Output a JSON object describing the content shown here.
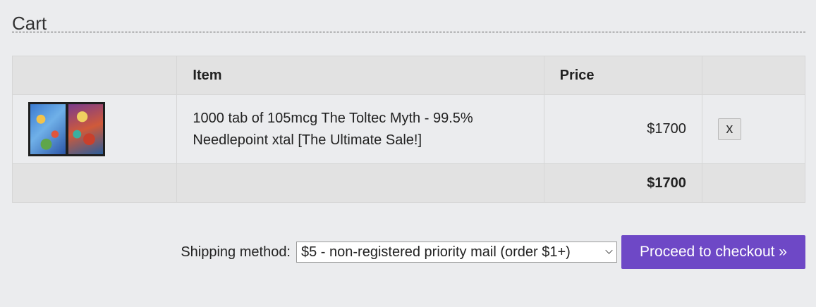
{
  "page": {
    "title": "Cart"
  },
  "table": {
    "headers": {
      "image": "",
      "item": "Item",
      "price": "Price",
      "action": ""
    },
    "rows": [
      {
        "name": "1000 tab of 105mcg The Toltec Myth - 99.5% Needlepoint xtal [The Ultimate Sale!]",
        "price": "$1700",
        "remove_label": "x"
      }
    ],
    "total": "$1700"
  },
  "shipping": {
    "label": "Shipping method:",
    "selected": "$5 - non-registered priority mail (order $1+)"
  },
  "checkout": {
    "label": "Proceed to checkout »",
    "accent": "#6e48c6"
  }
}
